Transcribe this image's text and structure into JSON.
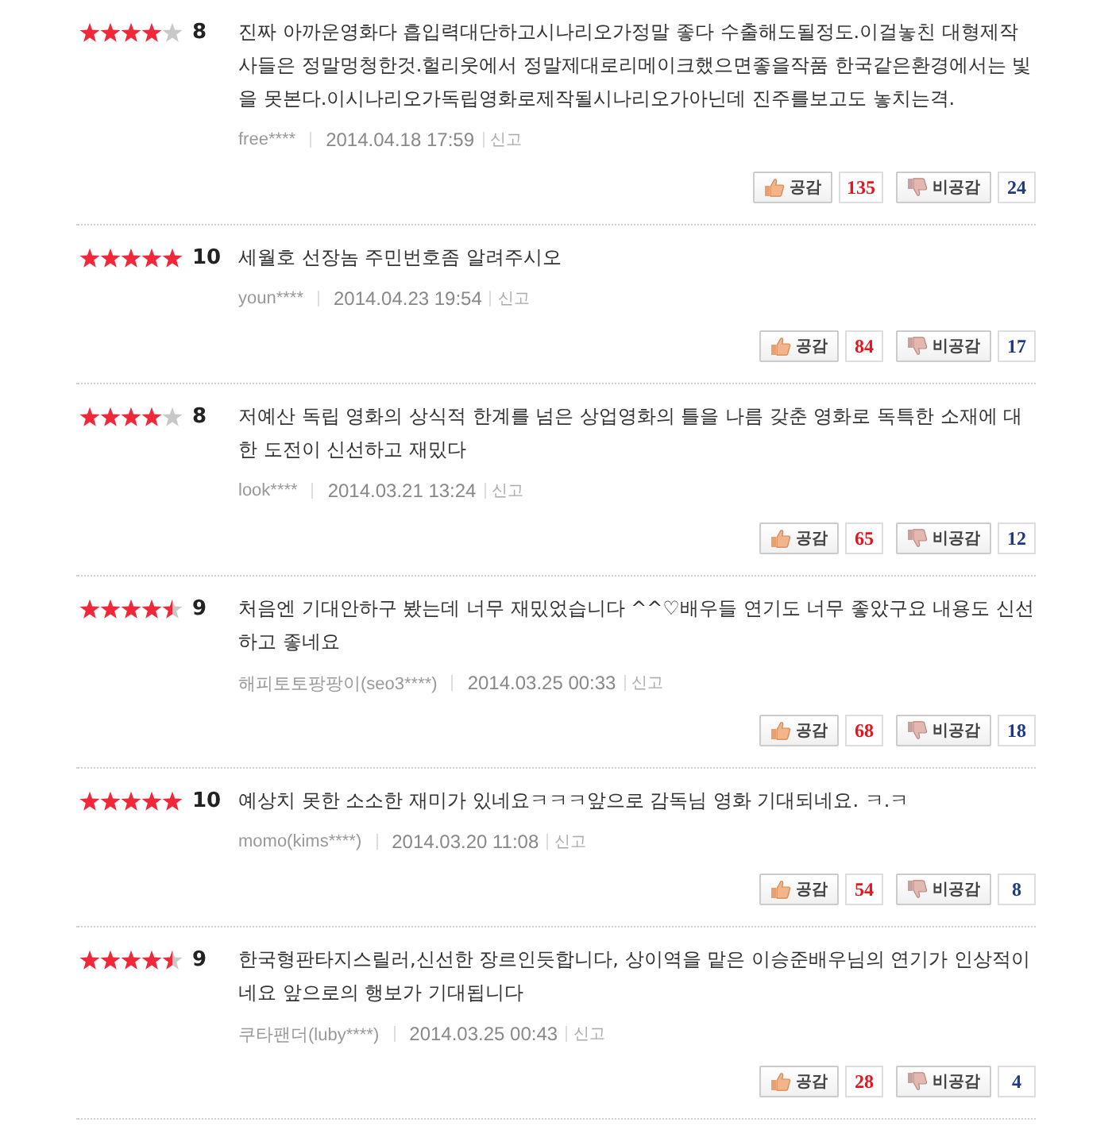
{
  "reviews": [
    {
      "stars": 4,
      "score": "8",
      "text": "진짜 아까운영화다 흡입력대단하고시나리오가정말 좋다 수출해도될정도.이걸놓친 대형제작사들은 정말멍청한것.헐리웃에서 정말제대로리메이크했으면좋을작품 한국같은환경에서는 빛을 못본다.이시나리오가독립영화로제작될시나리오가아닌데 진주를보고도 놓치는격.",
      "author": "free****",
      "date": "2014.04.18 17:59",
      "report": "신고",
      "agree": {
        "label": "공감",
        "count": "135"
      },
      "disagree": {
        "label": "비공감",
        "count": "24"
      }
    },
    {
      "stars": 5,
      "score": "10",
      "text": "세월호 선장놈 주민번호좀 알려주시오",
      "author": "youn****",
      "date": "2014.04.23 19:54",
      "report": "신고",
      "agree": {
        "label": "공감",
        "count": "84"
      },
      "disagree": {
        "label": "비공감",
        "count": "17"
      }
    },
    {
      "stars": 4,
      "score": "8",
      "text": "저예산 독립 영화의 상식적 한계를 넘은 상업영화의 틀을 나름 갖춘 영화로 독특한 소재에 대한 도전이 신선하고 재밌다",
      "author": "look****",
      "date": "2014.03.21 13:24",
      "report": "신고",
      "agree": {
        "label": "공감",
        "count": "65"
      },
      "disagree": {
        "label": "비공감",
        "count": "12"
      }
    },
    {
      "stars": 4.5,
      "score": "9",
      "text": "처음엔 기대안하구 봤는데 너무 재밌었습니다 ^^♡배우들 연기도 너무 좋았구요 내용도 신선하고 좋네요",
      "author": "해피토토팡팡이(seo3****)",
      "date": "2014.03.25 00:33",
      "report": "신고",
      "agree": {
        "label": "공감",
        "count": "68"
      },
      "disagree": {
        "label": "비공감",
        "count": "18"
      }
    },
    {
      "stars": 5,
      "score": "10",
      "text": "예상치 못한 소소한 재미가 있네요ㅋㅋㅋ앞으로 감독님 영화 기대되네요. ㅋ.ㅋ",
      "author": "momo(kims****)",
      "date": "2014.03.20 11:08",
      "report": "신고",
      "agree": {
        "label": "공감",
        "count": "54"
      },
      "disagree": {
        "label": "비공감",
        "count": "8"
      }
    },
    {
      "stars": 4.5,
      "score": "9",
      "text": "한국형판타지스릴러,신선한 장르인듯합니다, 상이역을 맡은 이승준배우님의 연기가 인상적이네요 앞으로의 행보가 기대됩니다",
      "author": "쿠타팬더(luby****)",
      "date": "2014.03.25 00:43",
      "report": "신고",
      "agree": {
        "label": "공감",
        "count": "28"
      },
      "disagree": {
        "label": "비공감",
        "count": "4"
      }
    }
  ]
}
